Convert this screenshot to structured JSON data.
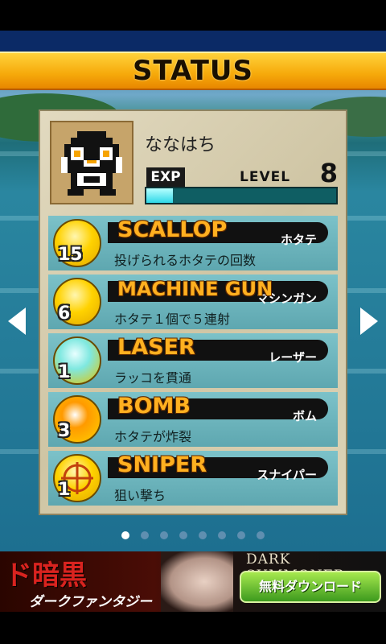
{
  "screen": {
    "title": "STATUS"
  },
  "player": {
    "name": "ななはち",
    "exp_label": "EXP",
    "level_label": "LEVEL",
    "level": "8",
    "exp_fraction": 0.14
  },
  "skills": [
    {
      "name": "SCALLOP",
      "jp": "ホタテ",
      "desc": "投げられるホタテの回数",
      "count": "15",
      "icon": "scallop-icon"
    },
    {
      "name": "MACHINE GUN",
      "jp": "マシンガン",
      "desc": "ホタテ１個で５連射",
      "count": "6",
      "icon": "machine-gun-scallop-icon"
    },
    {
      "name": "LASER",
      "jp": "レーザー",
      "desc": "ラッコを貫通",
      "count": "1",
      "icon": "laser-scallop-icon"
    },
    {
      "name": "BOMB",
      "jp": "ボム",
      "desc": "ホタテが炸裂",
      "count": "3",
      "icon": "bomb-scallop-icon"
    },
    {
      "name": "SNIPER",
      "jp": "スナイパー",
      "desc": "狙い撃ち",
      "count": "1",
      "icon": "crosshair-icon"
    }
  ],
  "pager": {
    "total": 8,
    "active": 0
  },
  "ad": {
    "headline": "ド暗黒",
    "subline": "ダークファンタジー",
    "brand": "DARK SUMMONER",
    "cta": "無料ダウンロード"
  },
  "colors": {
    "banner": "#f6a90a",
    "skill_name": "#ffb020",
    "exp_fill": "#2fd8e8",
    "panel": "#d8cfb0"
  }
}
